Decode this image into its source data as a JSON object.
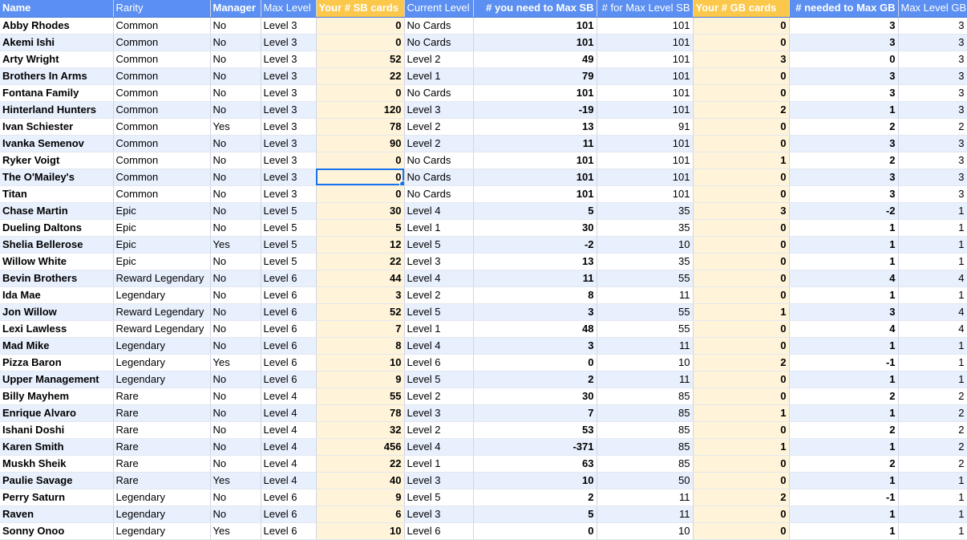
{
  "headers": [
    "Name",
    "Rarity",
    "Manager",
    "Max Level",
    "Your # SB cards",
    "Current Level",
    "# you need to Max SB",
    "# for Max Level SB",
    "Your # GB cards",
    "# needed to Max GB",
    "Max Level GB"
  ],
  "rows": [
    [
      "Abby Rhodes",
      "Common",
      "No",
      "Level 3",
      "0",
      "No Cards",
      "101",
      "101",
      "0",
      "3",
      "3"
    ],
    [
      "Akemi Ishi",
      "Common",
      "No",
      "Level 3",
      "0",
      "No Cards",
      "101",
      "101",
      "0",
      "3",
      "3"
    ],
    [
      "Arty Wright",
      "Common",
      "No",
      "Level 3",
      "52",
      "Level 2",
      "49",
      "101",
      "3",
      "0",
      "3"
    ],
    [
      "Brothers In Arms",
      "Common",
      "No",
      "Level 3",
      "22",
      "Level 1",
      "79",
      "101",
      "0",
      "3",
      "3"
    ],
    [
      "Fontana Family",
      "Common",
      "No",
      "Level 3",
      "0",
      "No Cards",
      "101",
      "101",
      "0",
      "3",
      "3"
    ],
    [
      "Hinterland Hunters",
      "Common",
      "No",
      "Level 3",
      "120",
      "Level 3",
      "-19",
      "101",
      "2",
      "1",
      "3"
    ],
    [
      "Ivan Schiester",
      "Common",
      "Yes",
      "Level 3",
      "78",
      "Level 2",
      "13",
      "91",
      "0",
      "2",
      "2"
    ],
    [
      "Ivanka Semenov",
      "Common",
      "No",
      "Level 3",
      "90",
      "Level 2",
      "11",
      "101",
      "0",
      "3",
      "3"
    ],
    [
      "Ryker Voigt",
      "Common",
      "No",
      "Level 3",
      "0",
      "No Cards",
      "101",
      "101",
      "1",
      "2",
      "3"
    ],
    [
      "The O'Mailey's",
      "Common",
      "No",
      "Level 3",
      "0",
      "No Cards",
      "101",
      "101",
      "0",
      "3",
      "3"
    ],
    [
      "Titan",
      "Common",
      "No",
      "Level 3",
      "0",
      "No Cards",
      "101",
      "101",
      "0",
      "3",
      "3"
    ],
    [
      "Chase Martin",
      "Epic",
      "No",
      "Level 5",
      "30",
      "Level 4",
      "5",
      "35",
      "3",
      "-2",
      "1"
    ],
    [
      "Dueling Daltons",
      "Epic",
      "No",
      "Level 5",
      "5",
      "Level 1",
      "30",
      "35",
      "0",
      "1",
      "1"
    ],
    [
      "Shelia Bellerose",
      "Epic",
      "Yes",
      "Level 5",
      "12",
      "Level 5",
      "-2",
      "10",
      "0",
      "1",
      "1"
    ],
    [
      "Willow White",
      "Epic",
      "No",
      "Level 5",
      "22",
      "Level 3",
      "13",
      "35",
      "0",
      "1",
      "1"
    ],
    [
      "Bevin Brothers",
      "Reward Legendary",
      "No",
      "Level 6",
      "44",
      "Level 4",
      "11",
      "55",
      "0",
      "4",
      "4"
    ],
    [
      "Ida Mae",
      "Legendary",
      "No",
      "Level 6",
      "3",
      "Level 2",
      "8",
      "11",
      "0",
      "1",
      "1"
    ],
    [
      "Jon Willow",
      "Reward Legendary",
      "No",
      "Level 6",
      "52",
      "Level 5",
      "3",
      "55",
      "1",
      "3",
      "4"
    ],
    [
      "Lexi Lawless",
      "Reward Legendary",
      "No",
      "Level 6",
      "7",
      "Level 1",
      "48",
      "55",
      "0",
      "4",
      "4"
    ],
    [
      "Mad Mike",
      "Legendary",
      "No",
      "Level 6",
      "8",
      "Level 4",
      "3",
      "11",
      "0",
      "1",
      "1"
    ],
    [
      "Pizza Baron",
      "Legendary",
      "Yes",
      "Level 6",
      "10",
      "Level 6",
      "0",
      "10",
      "2",
      "-1",
      "1"
    ],
    [
      "Upper Management",
      "Legendary",
      "No",
      "Level 6",
      "9",
      "Level 5",
      "2",
      "11",
      "0",
      "1",
      "1"
    ],
    [
      "Billy Mayhem",
      "Rare",
      "No",
      "Level 4",
      "55",
      "Level 2",
      "30",
      "85",
      "0",
      "2",
      "2"
    ],
    [
      "Enrique Alvaro",
      "Rare",
      "No",
      "Level 4",
      "78",
      "Level 3",
      "7",
      "85",
      "1",
      "1",
      "2"
    ],
    [
      "Ishani Doshi",
      "Rare",
      "No",
      "Level 4",
      "32",
      "Level 2",
      "53",
      "85",
      "0",
      "2",
      "2"
    ],
    [
      "Karen Smith",
      "Rare",
      "No",
      "Level 4",
      "456",
      "Level 4",
      "-371",
      "85",
      "1",
      "1",
      "2"
    ],
    [
      "Muskh Sheik",
      "Rare",
      "No",
      "Level 4",
      "22",
      "Level 1",
      "63",
      "85",
      "0",
      "2",
      "2"
    ],
    [
      "Paulie Savage",
      "Rare",
      "Yes",
      "Level 4",
      "40",
      "Level 3",
      "10",
      "50",
      "0",
      "1",
      "1"
    ],
    [
      "Perry Saturn",
      "Legendary",
      "No",
      "Level 6",
      "9",
      "Level 5",
      "2",
      "11",
      "2",
      "-1",
      "1"
    ],
    [
      "Raven",
      "Legendary",
      "No",
      "Level 6",
      "6",
      "Level 3",
      "5",
      "11",
      "0",
      "1",
      "1"
    ],
    [
      "Sonny Onoo",
      "Legendary",
      "Yes",
      "Level 6",
      "10",
      "Level 6",
      "0",
      "10",
      "0",
      "1",
      "1"
    ]
  ],
  "colors": {
    "header": "#5b8ff2",
    "header_gold": "#fbc84b",
    "stripe": "#e8f0fe",
    "gold_cell": "#fff4d9",
    "selection": "#1a73e8"
  },
  "selected_cell": {
    "row": 9,
    "col": 4
  }
}
